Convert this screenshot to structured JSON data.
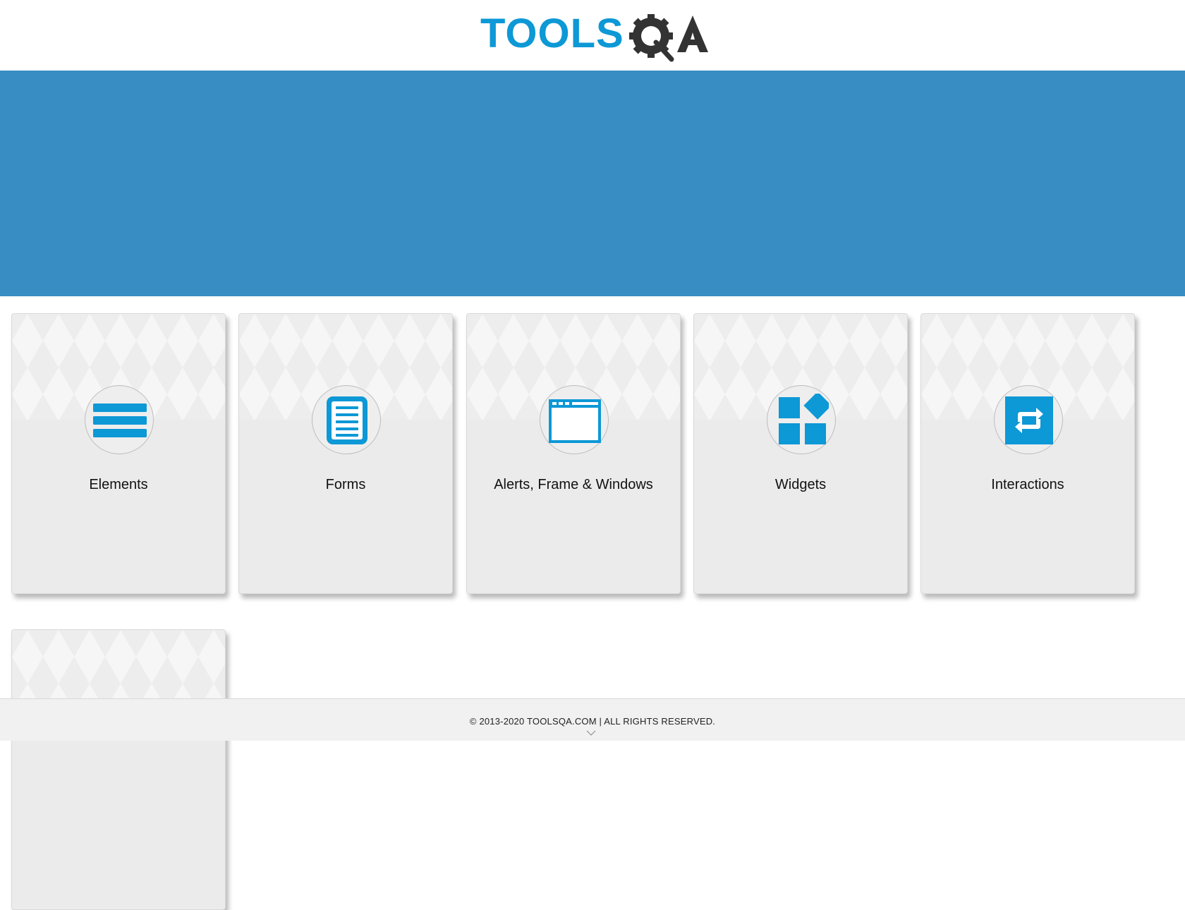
{
  "header": {
    "logo_text": "TOOLS",
    "logo_alt": "TOOLSQA"
  },
  "colors": {
    "accent": "#0d98d6",
    "banner": "#388ec3",
    "card_bg": "#ebebeb",
    "logo_dark": "#333333"
  },
  "cards": [
    {
      "label": "Elements",
      "icon": "hamburger-list-icon"
    },
    {
      "label": "Forms",
      "icon": "document-icon"
    },
    {
      "label": "Alerts, Frame & Windows",
      "icon": "browser-window-icon"
    },
    {
      "label": "Widgets",
      "icon": "widgets-icon"
    },
    {
      "label": "Interactions",
      "icon": "repeat-arrows-icon"
    },
    {
      "label": "",
      "icon": ""
    }
  ],
  "footer": {
    "copyright": "© 2013-2020 TOOLSQA.COM | ALL RIGHTS RESERVED."
  }
}
